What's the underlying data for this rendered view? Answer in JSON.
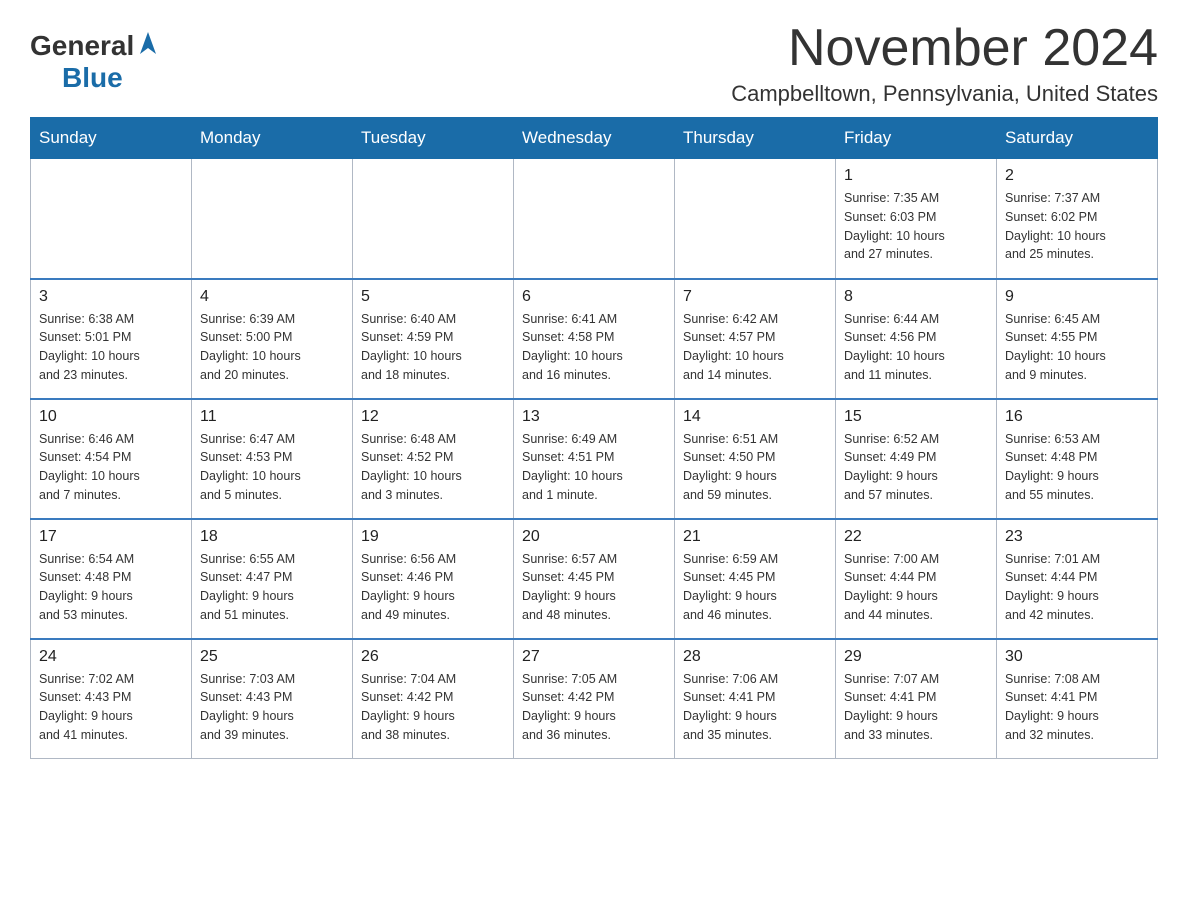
{
  "logo": {
    "general": "General",
    "blue": "Blue"
  },
  "title": "November 2024",
  "location": "Campbelltown, Pennsylvania, United States",
  "days_of_week": [
    "Sunday",
    "Monday",
    "Tuesday",
    "Wednesday",
    "Thursday",
    "Friday",
    "Saturday"
  ],
  "weeks": [
    [
      {
        "day": "",
        "info": ""
      },
      {
        "day": "",
        "info": ""
      },
      {
        "day": "",
        "info": ""
      },
      {
        "day": "",
        "info": ""
      },
      {
        "day": "",
        "info": ""
      },
      {
        "day": "1",
        "info": "Sunrise: 7:35 AM\nSunset: 6:03 PM\nDaylight: 10 hours\nand 27 minutes."
      },
      {
        "day": "2",
        "info": "Sunrise: 7:37 AM\nSunset: 6:02 PM\nDaylight: 10 hours\nand 25 minutes."
      }
    ],
    [
      {
        "day": "3",
        "info": "Sunrise: 6:38 AM\nSunset: 5:01 PM\nDaylight: 10 hours\nand 23 minutes."
      },
      {
        "day": "4",
        "info": "Sunrise: 6:39 AM\nSunset: 5:00 PM\nDaylight: 10 hours\nand 20 minutes."
      },
      {
        "day": "5",
        "info": "Sunrise: 6:40 AM\nSunset: 4:59 PM\nDaylight: 10 hours\nand 18 minutes."
      },
      {
        "day": "6",
        "info": "Sunrise: 6:41 AM\nSunset: 4:58 PM\nDaylight: 10 hours\nand 16 minutes."
      },
      {
        "day": "7",
        "info": "Sunrise: 6:42 AM\nSunset: 4:57 PM\nDaylight: 10 hours\nand 14 minutes."
      },
      {
        "day": "8",
        "info": "Sunrise: 6:44 AM\nSunset: 4:56 PM\nDaylight: 10 hours\nand 11 minutes."
      },
      {
        "day": "9",
        "info": "Sunrise: 6:45 AM\nSunset: 4:55 PM\nDaylight: 10 hours\nand 9 minutes."
      }
    ],
    [
      {
        "day": "10",
        "info": "Sunrise: 6:46 AM\nSunset: 4:54 PM\nDaylight: 10 hours\nand 7 minutes."
      },
      {
        "day": "11",
        "info": "Sunrise: 6:47 AM\nSunset: 4:53 PM\nDaylight: 10 hours\nand 5 minutes."
      },
      {
        "day": "12",
        "info": "Sunrise: 6:48 AM\nSunset: 4:52 PM\nDaylight: 10 hours\nand 3 minutes."
      },
      {
        "day": "13",
        "info": "Sunrise: 6:49 AM\nSunset: 4:51 PM\nDaylight: 10 hours\nand 1 minute."
      },
      {
        "day": "14",
        "info": "Sunrise: 6:51 AM\nSunset: 4:50 PM\nDaylight: 9 hours\nand 59 minutes."
      },
      {
        "day": "15",
        "info": "Sunrise: 6:52 AM\nSunset: 4:49 PM\nDaylight: 9 hours\nand 57 minutes."
      },
      {
        "day": "16",
        "info": "Sunrise: 6:53 AM\nSunset: 4:48 PM\nDaylight: 9 hours\nand 55 minutes."
      }
    ],
    [
      {
        "day": "17",
        "info": "Sunrise: 6:54 AM\nSunset: 4:48 PM\nDaylight: 9 hours\nand 53 minutes."
      },
      {
        "day": "18",
        "info": "Sunrise: 6:55 AM\nSunset: 4:47 PM\nDaylight: 9 hours\nand 51 minutes."
      },
      {
        "day": "19",
        "info": "Sunrise: 6:56 AM\nSunset: 4:46 PM\nDaylight: 9 hours\nand 49 minutes."
      },
      {
        "day": "20",
        "info": "Sunrise: 6:57 AM\nSunset: 4:45 PM\nDaylight: 9 hours\nand 48 minutes."
      },
      {
        "day": "21",
        "info": "Sunrise: 6:59 AM\nSunset: 4:45 PM\nDaylight: 9 hours\nand 46 minutes."
      },
      {
        "day": "22",
        "info": "Sunrise: 7:00 AM\nSunset: 4:44 PM\nDaylight: 9 hours\nand 44 minutes."
      },
      {
        "day": "23",
        "info": "Sunrise: 7:01 AM\nSunset: 4:44 PM\nDaylight: 9 hours\nand 42 minutes."
      }
    ],
    [
      {
        "day": "24",
        "info": "Sunrise: 7:02 AM\nSunset: 4:43 PM\nDaylight: 9 hours\nand 41 minutes."
      },
      {
        "day": "25",
        "info": "Sunrise: 7:03 AM\nSunset: 4:43 PM\nDaylight: 9 hours\nand 39 minutes."
      },
      {
        "day": "26",
        "info": "Sunrise: 7:04 AM\nSunset: 4:42 PM\nDaylight: 9 hours\nand 38 minutes."
      },
      {
        "day": "27",
        "info": "Sunrise: 7:05 AM\nSunset: 4:42 PM\nDaylight: 9 hours\nand 36 minutes."
      },
      {
        "day": "28",
        "info": "Sunrise: 7:06 AM\nSunset: 4:41 PM\nDaylight: 9 hours\nand 35 minutes."
      },
      {
        "day": "29",
        "info": "Sunrise: 7:07 AM\nSunset: 4:41 PM\nDaylight: 9 hours\nand 33 minutes."
      },
      {
        "day": "30",
        "info": "Sunrise: 7:08 AM\nSunset: 4:41 PM\nDaylight: 9 hours\nand 32 minutes."
      }
    ]
  ]
}
